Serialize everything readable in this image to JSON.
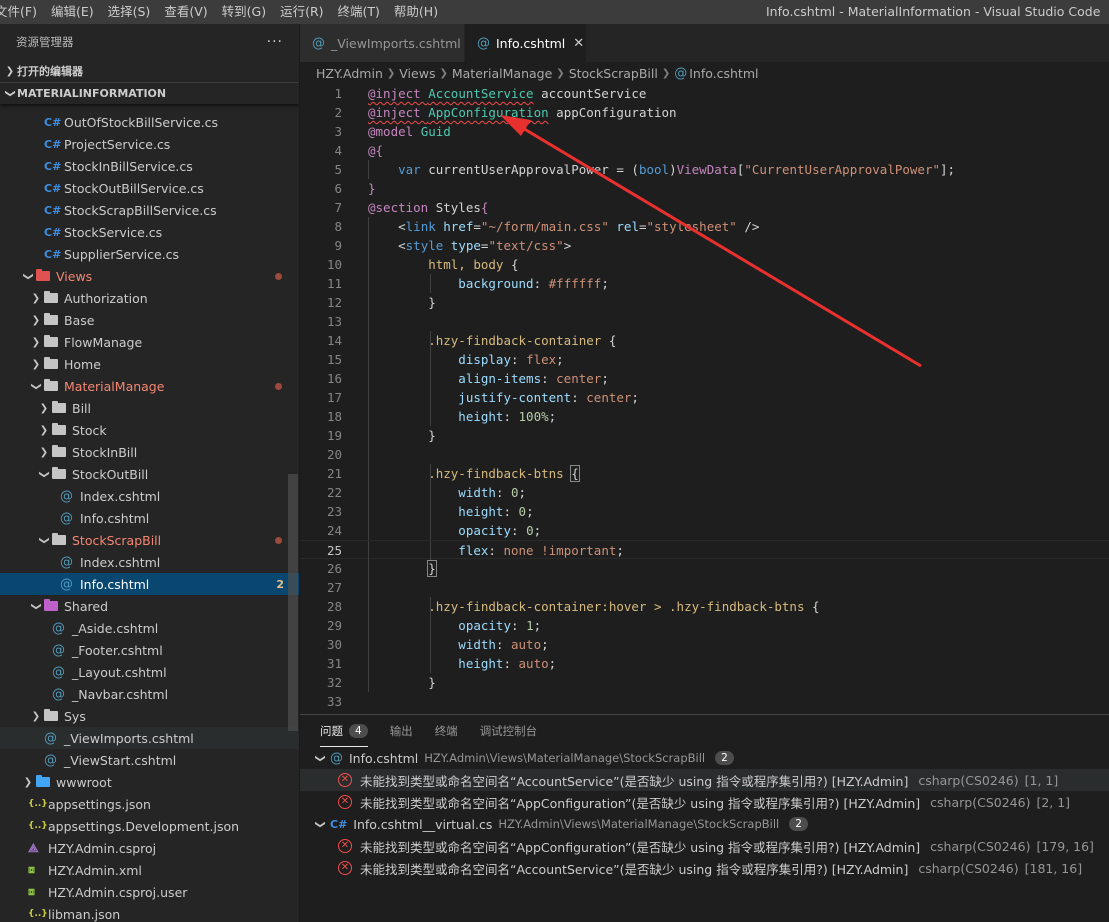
{
  "menu": [
    "文件(F)",
    "编辑(E)",
    "选择(S)",
    "查看(V)",
    "转到(G)",
    "运行(R)",
    "终端(T)",
    "帮助(H)"
  ],
  "window_title": "Info.cshtml - MaterialInformation - Visual Studio Code",
  "sidebar": {
    "title": "资源管理器",
    "more": "···",
    "open_editors": "打开的编辑器",
    "project": "MATERIALINFORMATION",
    "tree": [
      {
        "label": "OutOfStockBillService.cs",
        "type": "cs"
      },
      {
        "label": "ProjectService.cs",
        "type": "cs"
      },
      {
        "label": "StockInBillService.cs",
        "type": "cs"
      },
      {
        "label": "StockOutBillService.cs",
        "type": "cs"
      },
      {
        "label": "StockScrapBillService.cs",
        "type": "cs"
      },
      {
        "label": "StockService.cs",
        "type": "cs"
      },
      {
        "label": "SupplierService.cs",
        "type": "cs"
      },
      {
        "label": "Views",
        "type": "folder-open",
        "color": "red",
        "modified": true
      },
      {
        "label": "Authorization",
        "type": "folder"
      },
      {
        "label": "Base",
        "type": "folder"
      },
      {
        "label": "FlowManage",
        "type": "folder"
      },
      {
        "label": "Home",
        "type": "folder"
      },
      {
        "label": "MaterialManage",
        "type": "folder-open",
        "modified": true
      },
      {
        "label": "Bill",
        "type": "folder"
      },
      {
        "label": "Stock",
        "type": "folder"
      },
      {
        "label": "StockInBill",
        "type": "folder"
      },
      {
        "label": "StockOutBill",
        "type": "folder-open"
      },
      {
        "label": "Index.cshtml",
        "type": "at"
      },
      {
        "label": "Info.cshtml",
        "type": "at"
      },
      {
        "label": "StockScrapBill",
        "type": "folder-open",
        "modified": true
      },
      {
        "label": "Index.cshtml",
        "type": "at"
      },
      {
        "label": "Info.cshtml",
        "type": "at",
        "selected": true,
        "errors": "2"
      },
      {
        "label": "Shared",
        "type": "folder-open",
        "color": "pink"
      },
      {
        "label": "_Aside.cshtml",
        "type": "at"
      },
      {
        "label": "_Footer.cshtml",
        "type": "at"
      },
      {
        "label": "_Layout.cshtml",
        "type": "at"
      },
      {
        "label": "_Navbar.cshtml",
        "type": "at"
      },
      {
        "label": "Sys",
        "type": "folder"
      },
      {
        "label": "_ViewImports.cshtml",
        "type": "at",
        "hover": true
      },
      {
        "label": "_ViewStart.cshtml",
        "type": "at"
      },
      {
        "label": "wwwroot",
        "type": "folder",
        "color": "blue"
      },
      {
        "label": "appsettings.json",
        "type": "json"
      },
      {
        "label": "appsettings.Development.json",
        "type": "json"
      },
      {
        "label": "HZY.Admin.csproj",
        "type": "proj"
      },
      {
        "label": "HZY.Admin.xml",
        "type": "xml"
      },
      {
        "label": "HZY.Admin.csproj.user",
        "type": "xml"
      },
      {
        "label": "libman.json",
        "type": "json"
      }
    ]
  },
  "tabs": [
    {
      "label": "_ViewImports.cshtml",
      "active": false
    },
    {
      "label": "Info.cshtml",
      "active": true,
      "close": "✕"
    }
  ],
  "breadcrumb": [
    "HZY.Admin",
    "Views",
    "MaterialManage",
    "StockScrapBill",
    "Info.cshtml"
  ],
  "code": {
    "current_line": 25,
    "lines": [
      [
        [
          "@inject ",
          "at sq"
        ],
        [
          "AccountService",
          "type sq"
        ],
        [
          " accountService",
          "var"
        ]
      ],
      [
        [
          "@inject ",
          "at sq"
        ],
        [
          "AppConfiguration",
          "type sq"
        ],
        [
          " appConfiguration",
          "var"
        ]
      ],
      [
        [
          "@model ",
          "at"
        ],
        [
          "Guid",
          "type"
        ]
      ],
      [
        [
          "@{",
          "at"
        ]
      ],
      [
        [
          "    var ",
          "kw"
        ],
        [
          "currentUserApprovalPower",
          "var"
        ],
        [
          " = (",
          "txt"
        ],
        [
          "bool",
          "kw"
        ],
        [
          ")",
          "txt"
        ],
        [
          "ViewData",
          "at"
        ],
        [
          "[",
          "txt"
        ],
        [
          "\"CurrentUserApprovalPower\"",
          "str"
        ],
        [
          "];",
          "txt"
        ]
      ],
      [
        [
          "}",
          "at"
        ]
      ],
      [
        [
          "@section ",
          "at"
        ],
        [
          "Styles",
          "var"
        ],
        [
          "{",
          "at"
        ]
      ],
      [
        [
          "    <",
          "txt"
        ],
        [
          "link ",
          "tag"
        ],
        [
          "href",
          "attr"
        ],
        [
          "=",
          "txt"
        ],
        [
          "\"~/form/main.css\"",
          "str"
        ],
        [
          " ",
          "txt"
        ],
        [
          "rel",
          "attr"
        ],
        [
          "=",
          "txt"
        ],
        [
          "\"stylesheet\"",
          "str"
        ],
        [
          " />",
          "txt"
        ]
      ],
      [
        [
          "    <",
          "txt"
        ],
        [
          "style ",
          "tag"
        ],
        [
          "type",
          "attr"
        ],
        [
          "=",
          "txt"
        ],
        [
          "\"text/css\"",
          "str"
        ],
        [
          ">",
          "txt"
        ]
      ],
      [
        [
          "        html, body ",
          "sel"
        ],
        [
          "{",
          "txt"
        ]
      ],
      [
        [
          "            background",
          "prop"
        ],
        [
          ": ",
          "txt"
        ],
        [
          "#ffffff",
          "val"
        ],
        [
          ";",
          "txt"
        ]
      ],
      [
        [
          "        }",
          "txt"
        ]
      ],
      [
        [
          "",
          "txt"
        ]
      ],
      [
        [
          "        .hzy-findback-container ",
          "sel"
        ],
        [
          "{",
          "txt"
        ]
      ],
      [
        [
          "            display",
          "prop"
        ],
        [
          ": ",
          "txt"
        ],
        [
          "flex",
          "val"
        ],
        [
          ";",
          "txt"
        ]
      ],
      [
        [
          "            align-items",
          "prop"
        ],
        [
          ": ",
          "txt"
        ],
        [
          "center",
          "val"
        ],
        [
          ";",
          "txt"
        ]
      ],
      [
        [
          "            justify-content",
          "prop"
        ],
        [
          ": ",
          "txt"
        ],
        [
          "center",
          "val"
        ],
        [
          ";",
          "txt"
        ]
      ],
      [
        [
          "            height",
          "prop"
        ],
        [
          ": ",
          "txt"
        ],
        [
          "100%",
          "num"
        ],
        [
          ";",
          "txt"
        ]
      ],
      [
        [
          "        }",
          "txt"
        ]
      ],
      [
        [
          "",
          "txt"
        ]
      ],
      [
        [
          "        .hzy-findback-btns ",
          "sel"
        ],
        [
          "{",
          "txt hl"
        ]
      ],
      [
        [
          "            width",
          "prop"
        ],
        [
          ": ",
          "txt"
        ],
        [
          "0",
          "num"
        ],
        [
          ";",
          "txt"
        ]
      ],
      [
        [
          "            height",
          "prop"
        ],
        [
          ": ",
          "txt"
        ],
        [
          "0",
          "num"
        ],
        [
          ";",
          "txt"
        ]
      ],
      [
        [
          "            opacity",
          "prop"
        ],
        [
          ": ",
          "txt"
        ],
        [
          "0",
          "num"
        ],
        [
          ";",
          "txt"
        ]
      ],
      [
        [
          "            flex",
          "prop"
        ],
        [
          ": ",
          "txt"
        ],
        [
          "none !important",
          "val"
        ],
        [
          ";",
          "txt"
        ]
      ],
      [
        [
          "        ",
          "txt"
        ],
        [
          "}",
          "txt hl"
        ]
      ],
      [
        [
          "",
          "txt"
        ]
      ],
      [
        [
          "        .hzy-findback-container:hover > .hzy-findback-btns ",
          "sel"
        ],
        [
          "{",
          "txt"
        ]
      ],
      [
        [
          "            opacity",
          "prop"
        ],
        [
          ": ",
          "txt"
        ],
        [
          "1",
          "num"
        ],
        [
          ";",
          "txt"
        ]
      ],
      [
        [
          "            width",
          "prop"
        ],
        [
          ": ",
          "txt"
        ],
        [
          "auto",
          "val"
        ],
        [
          ";",
          "txt"
        ]
      ],
      [
        [
          "            height",
          "prop"
        ],
        [
          ": ",
          "txt"
        ],
        [
          "auto",
          "val"
        ],
        [
          ";",
          "txt"
        ]
      ],
      [
        [
          "        }",
          "txt"
        ]
      ],
      [
        [
          "",
          "txt"
        ]
      ]
    ]
  },
  "panel": {
    "tabs": [
      {
        "label": "问题",
        "count": "4",
        "active": true
      },
      {
        "label": "输出"
      },
      {
        "label": "终端"
      },
      {
        "label": "调试控制台"
      }
    ],
    "groups": [
      {
        "file": "Info.cshtml",
        "icon": "@",
        "path": "HZY.Admin\\Views\\MaterialManage\\StockScrapBill",
        "count": "2",
        "items": [
          {
            "msg": "未能找到类型或命名空间名“AccountService”(是否缺少 using 指令或程序集引用?) [HZY.Admin]",
            "src": "csharp(CS0246)",
            "pos": "[1, 1]",
            "hover": true
          },
          {
            "msg": "未能找到类型或命名空间名“AppConfiguration”(是否缺少 using 指令或程序集引用?) [HZY.Admin]",
            "src": "csharp(CS0246)",
            "pos": "[2, 1]"
          }
        ]
      },
      {
        "file": "Info.cshtml__virtual.cs",
        "icon": "C#",
        "path": "HZY.Admin\\Views\\MaterialManage\\StockScrapBill",
        "count": "2",
        "items": [
          {
            "msg": "未能找到类型或命名空间名“AppConfiguration”(是否缺少 using 指令或程序集引用?) [HZY.Admin]",
            "src": "csharp(CS0246)",
            "pos": "[179, 16]"
          },
          {
            "msg": "未能找到类型或命名空间名“AccountService”(是否缺少 using 指令或程序集引用?) [HZY.Admin]",
            "src": "csharp(CS0246)",
            "pos": "[181, 16]"
          }
        ]
      }
    ]
  },
  "colors": {
    "accent": "#094771",
    "error": "#f14c4c",
    "arrow": "#e8312f"
  }
}
